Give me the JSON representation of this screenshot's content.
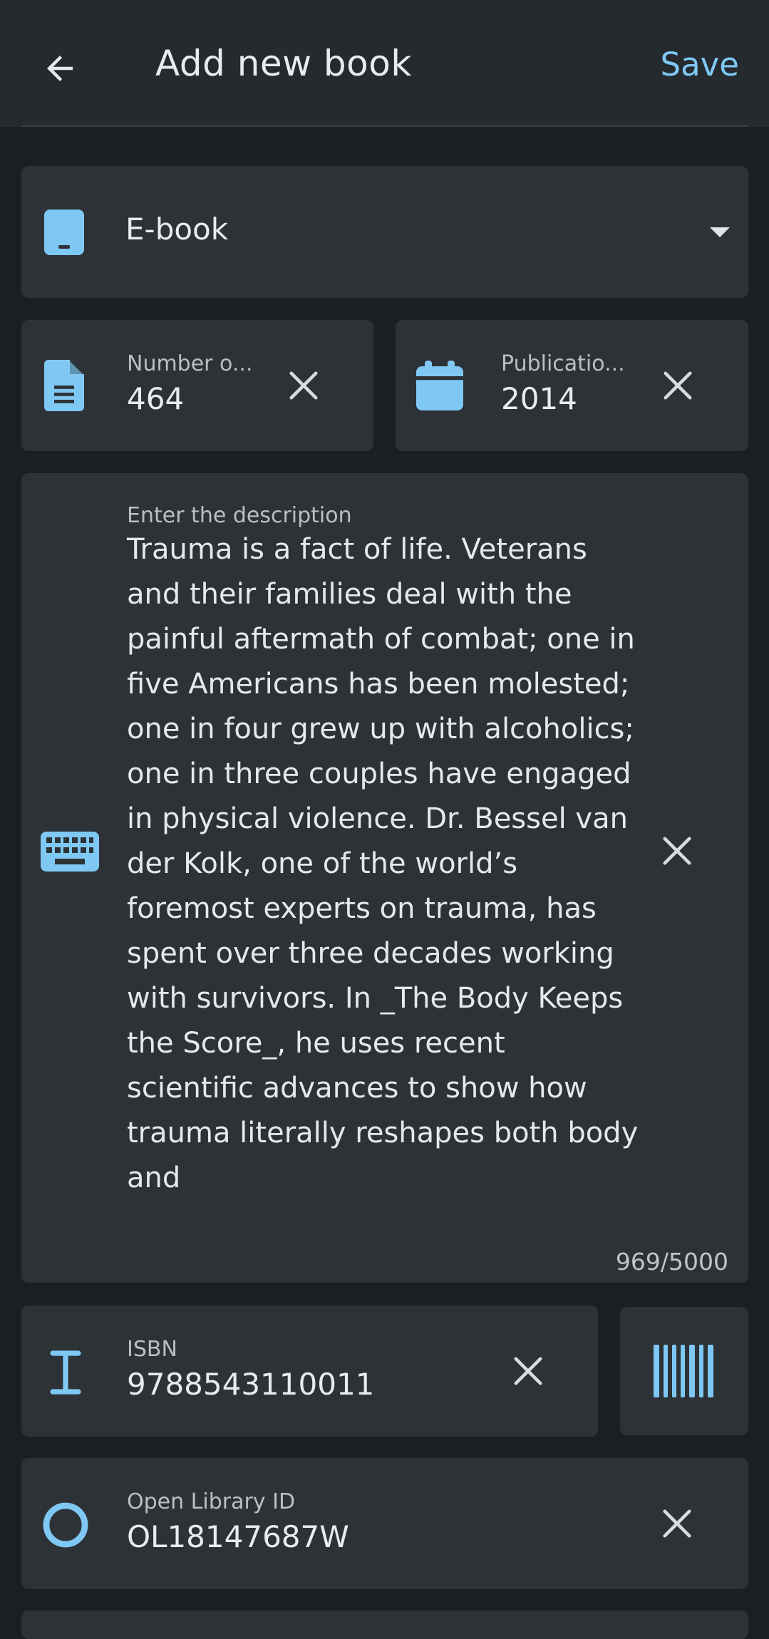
{
  "appbar": {
    "title": "Add new book",
    "save_label": "Save"
  },
  "book_format": {
    "value": "E-book"
  },
  "pages": {
    "label": "Number o...",
    "value": "464"
  },
  "publication": {
    "label": "Publicatio...",
    "value": "2014"
  },
  "description": {
    "label": "Enter the description",
    "value": "Trauma is a fact of life. Veterans and their families deal with the painful aftermath of combat; one in five Americans has been molested; one in four grew up with alcoholics; one in three couples have engaged in physical violence. Dr. Bessel van der Kolk, one of the world’s foremost experts on trauma, has spent over three decades working with survivors. In _The Body Keeps the Score_, he uses recent scientific advances to show how trauma literally reshapes both body and",
    "counter": "969/5000"
  },
  "isbn": {
    "label": "ISBN",
    "value": "9788543110011"
  },
  "olid": {
    "label": "Open Library ID",
    "value": "OL18147687W"
  },
  "colors": {
    "accent": "#7fc8f4",
    "background": "#1c1f22",
    "card": "#2d3237",
    "appbar": "#252a2f"
  }
}
